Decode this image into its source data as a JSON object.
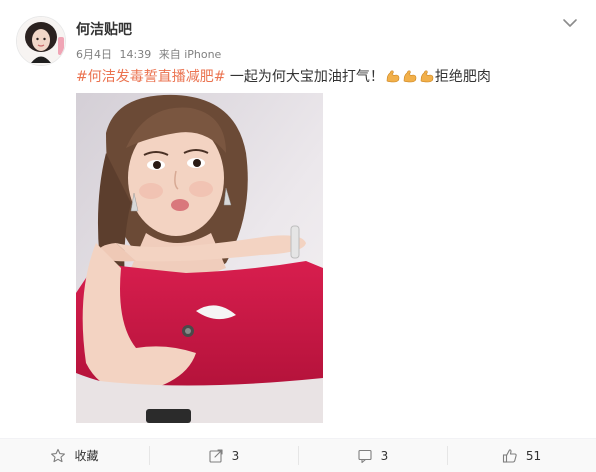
{
  "header": {
    "username": "何洁贴吧",
    "date": "6月4日",
    "time": "14:39",
    "source": "来自 iPhone"
  },
  "post": {
    "hashtag": "#何洁发毒誓直播减肥#",
    "text_main": " 一起为何大宝加油打气！",
    "emoji": "flexed-biceps-emoji",
    "emoji_count": 3,
    "text_tail": "拒绝肥肉"
  },
  "footer": {
    "favorite_label": "收藏",
    "repost_count": "3",
    "comment_count": "3",
    "like_count": "51"
  },
  "colors": {
    "hashtag": "#eb7350",
    "text": "#333333",
    "meta": "#808080",
    "footer_bg": "#f9f9f9",
    "icon": "#7f7f7f"
  }
}
